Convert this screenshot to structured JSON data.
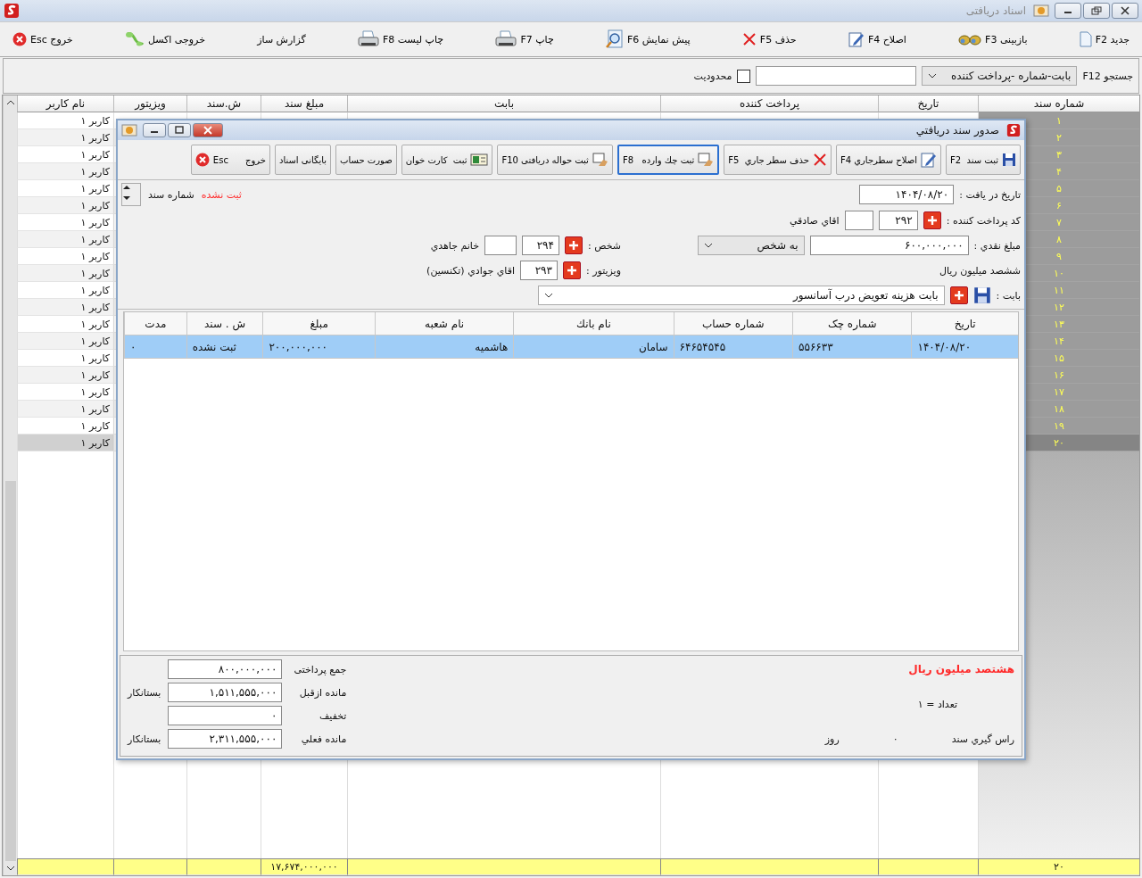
{
  "window": {
    "title": "اسناد دریافتی"
  },
  "toolbar": [
    {
      "label": "جدید F2"
    },
    {
      "label": "بازبینی F3"
    },
    {
      "label": "اصلاح F4"
    },
    {
      "label": "حذف F5"
    },
    {
      "label": "پیش نمایش F6"
    },
    {
      "label": "چاپ F7"
    },
    {
      "label": "چاپ لیست F8"
    },
    {
      "label": "گزارش ساز"
    },
    {
      "label": "خروجی اکسل"
    },
    {
      "label": "خروج Esc"
    }
  ],
  "search": {
    "label": "جستجو F12",
    "field": "بابت-شماره -پرداخت کننده",
    "limit_label": "محدودیت",
    "limit_checked": false
  },
  "grid": {
    "columns": [
      "شماره سند",
      "تاریخ",
      "پرداخت کننده",
      "بابت",
      "مبلغ سند",
      "ش.سند",
      "ویزیتور",
      "نام کاربر"
    ],
    "rows": [
      {
        "number": "۱",
        "user": "کاربر ۱",
        "selected": false
      },
      {
        "number": "۲",
        "user": "کاربر ۱",
        "selected": false
      },
      {
        "number": "۳",
        "user": "کاربر ۱",
        "selected": false
      },
      {
        "number": "۴",
        "user": "کاربر ۱",
        "selected": false
      },
      {
        "number": "۵",
        "user": "کاربر ۱",
        "selected": false
      },
      {
        "number": "۶",
        "user": "کاربر ۱",
        "selected": false
      },
      {
        "number": "۷",
        "user": "کاربر ۱",
        "selected": false
      },
      {
        "number": "۸",
        "user": "کاربر ۱",
        "selected": false
      },
      {
        "number": "۹",
        "user": "کاربر ۱",
        "selected": false
      },
      {
        "number": "۱۰",
        "user": "کاربر ۱",
        "selected": false
      },
      {
        "number": "۱۱",
        "user": "کاربر ۱",
        "selected": false
      },
      {
        "number": "۱۲",
        "user": "کاربر ۱",
        "selected": false
      },
      {
        "number": "۱۳",
        "user": "کاربر ۱",
        "selected": false
      },
      {
        "number": "۱۴",
        "user": "کاربر ۱",
        "selected": false
      },
      {
        "number": "۱۵",
        "user": "کاربر ۱",
        "selected": false
      },
      {
        "number": "۱۶",
        "user": "کاربر ۱",
        "selected": false
      },
      {
        "number": "۱۷",
        "user": "کاربر ۱",
        "selected": false
      },
      {
        "number": "۱۸",
        "user": "کاربر ۱",
        "selected": false
      },
      {
        "number": "۱۹",
        "user": "کاربر ۱",
        "selected": false
      },
      {
        "number": "۲۰",
        "user": "کاربر ۱",
        "selected": true
      }
    ],
    "totals": {
      "count": "۲۰",
      "amount": "۱۷,۶۷۴,۰۰۰,۰۰۰"
    }
  },
  "dialog": {
    "title": "صدور سند دریافتي",
    "toolbar": [
      {
        "label": "ثبت سند  F2",
        "focused": false
      },
      {
        "label": "اصلاح سطرجاري F4",
        "focused": false
      },
      {
        "label": "حذف سطر جاري  F5",
        "focused": false
      },
      {
        "label": "ثبت چك وارده   F8",
        "focused": true
      },
      {
        "label": "ثبت حواله دریافتی F10",
        "focused": false
      },
      {
        "label": "ثبت  کارت خوان",
        "focused": false
      },
      {
        "label": "صورت حساب",
        "focused": false
      },
      {
        "label": "بایگانی اسناد",
        "focused": false
      },
      {
        "label": "خروج      Esc",
        "focused": false
      }
    ],
    "date": {
      "label": "تاریخ در یافت :",
      "value": "۱۴۰۴/۰۸/۲۰"
    },
    "doc_number": {
      "label": "شماره سند",
      "status": "ثبت نشده"
    },
    "payer": {
      "label": "کد پرداخت کننده :",
      "code": "۲۹۲",
      "name": "اقاي صادقي"
    },
    "cash": {
      "label": "مبلغ نقدي :",
      "value": "۶۰۰,۰۰۰,۰۰۰",
      "target": "به شخص",
      "words": "ششصد ميليون  ريال"
    },
    "person": {
      "label": "شخص :",
      "code": "۲۹۴",
      "name": "خانم جاهدي"
    },
    "visitor": {
      "label": "ویزیتور :",
      "code": "۲۹۳",
      "name": "اقاي جوادي (تكنسين)"
    },
    "subject": {
      "label": "بابت :",
      "value": "بابت هزينه تعويض درب آسانسور"
    },
    "cheques": {
      "columns": [
        "تاریخ",
        "شماره چک",
        "شماره حساب",
        "نام بانك",
        "نام شعبه",
        "مبلغ",
        "ش . سند",
        "مدت"
      ],
      "rows": [
        {
          "cells": [
            "۱۴۰۴/۰۸/۲۰",
            "۵۵۶۶۳۳",
            "۶۴۶۵۴۵۴۵",
            "سامان",
            "هاشمیه",
            "۲۰۰,۰۰۰,۰۰۰",
            "ثبت نشده",
            "۰"
          ],
          "selected": true
        }
      ]
    },
    "footer": {
      "amount_words": "هشتصد ميليون  ريال",
      "count": "تعداد = ۱",
      "rounding_label": "راس گيري سند",
      "rounding_value": "۰",
      "rounding_unit": "روز",
      "totals": [
        {
          "label": "جمع پرداختی",
          "value": "۸۰۰,۰۰۰,۰۰۰"
        },
        {
          "label": "مانده ازقبل",
          "value": "۱,۵۱۱,۵۵۵,۰۰۰",
          "side": "بستانکار"
        },
        {
          "label": "تخفیف",
          "value": "۰"
        },
        {
          "label": "مانده فعلي",
          "value": "۲,۳۱۱,۵۵۵,۰۰۰",
          "side": "بستانکار"
        }
      ]
    }
  }
}
